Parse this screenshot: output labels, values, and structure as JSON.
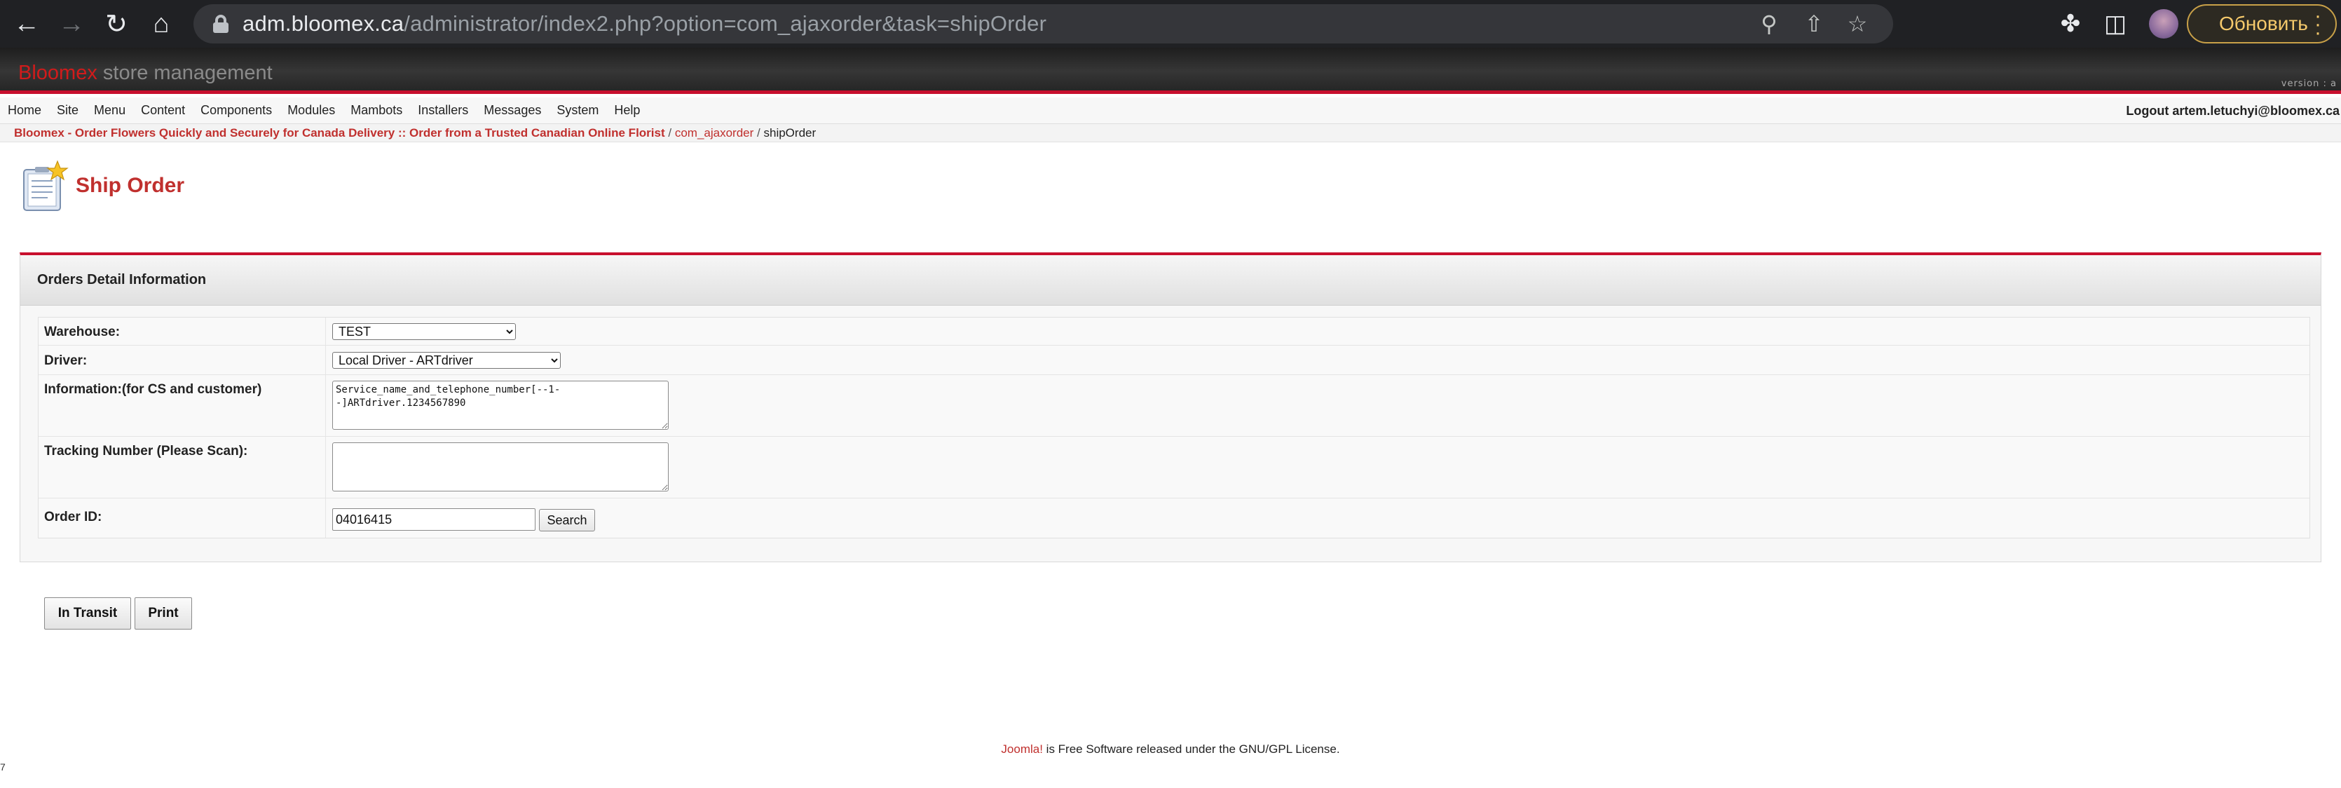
{
  "browser": {
    "url_host": "adm.bloomex.ca",
    "url_path": "/administrator/index2.php?option=com_ajaxorder&task=shipOrder",
    "update_label": "Обновить"
  },
  "header": {
    "brand_first": "Bloomex",
    "brand_second": "store management",
    "version": "version : a"
  },
  "menu": {
    "items": [
      "Home",
      "Site",
      "Menu",
      "Content",
      "Components",
      "Modules",
      "Mambots",
      "Installers",
      "Messages",
      "System",
      "Help"
    ],
    "logout": "Logout artem.letuchyi@bloomex.ca"
  },
  "breadcrumb": {
    "site": "Bloomex - Order Flowers Quickly and Securely for Canada Delivery :: Order from a Trusted Canadian Online Florist",
    "component": "com_ajaxorder",
    "current": "shipOrder",
    "separator": "/"
  },
  "page": {
    "title": "Ship Order"
  },
  "panel": {
    "heading": "Orders Detail Information",
    "warehouse_label": "Warehouse:",
    "warehouse_value": "TEST",
    "driver_label": "Driver:",
    "driver_value": "Local Driver - ARTdriver",
    "info_label": "Information:(for CS and customer)",
    "info_value": "Service_name_and_telephone_number[--1--]ARTdriver.1234567890",
    "tracking_label": "Tracking Number (Please Scan):",
    "tracking_value": "",
    "order_label": "Order ID:",
    "order_value": "04016415",
    "search_label": "Search"
  },
  "actions": {
    "in_transit": "In Transit",
    "print": "Print"
  },
  "footer": {
    "joomla": "Joomla!",
    "text": " is Free Software released under the GNU/GPL License."
  },
  "corner_text": "7"
}
